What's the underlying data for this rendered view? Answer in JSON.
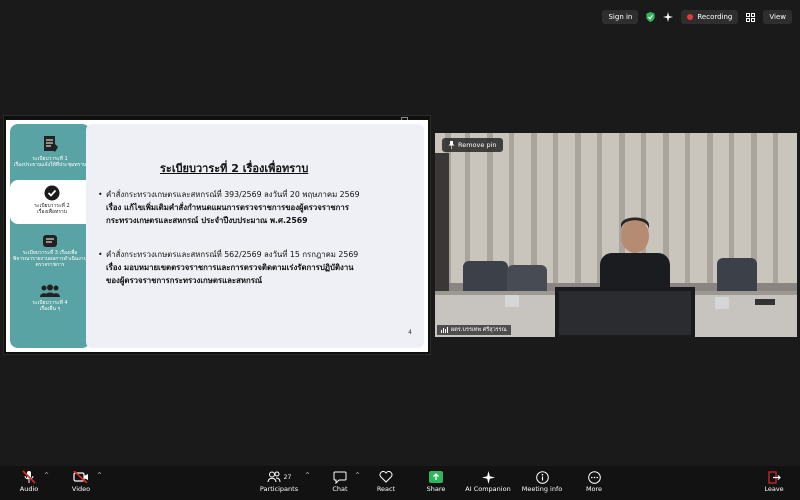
{
  "topbar": {
    "signin": "Sign in",
    "recording": "Recording",
    "view": "View"
  },
  "slide": {
    "sidebar": [
      {
        "label1": "ระเบียบวาระที่ 1",
        "label2": "เรื่องประธานแจ้งให้ที่ประชุมทราบ"
      },
      {
        "label1": "ระเบียบวาระที่ 2",
        "label2": "เรื่องเพื่อทราบ"
      },
      {
        "label1": "ระเบียบวาระที่ 3 เรื่องเพื่อ",
        "label2": "พิจารณารายงานผลการดำเนินงาน",
        "label3": "ตรวจราชการ"
      },
      {
        "label1": "ระเบียบวาระที่ 4",
        "label2": "เรื่องอื่น ๆ"
      }
    ],
    "title": "ระเบียบวาระที่ 2 เรื่องเพื่อทราบ",
    "bullets": [
      {
        "line1": "คำสั่งกระทรวงเกษตรและสหกรณ์ที่ 393/2569 ลงวันที่ 20 พฤษภาคม 2569",
        "line2": "เรื่อง แก้ไขเพิ่มเติมคำสั่งกำหนดแผนการตรวจราชการของผู้ตรวจราชการ",
        "line3": "กระทรวงเกษตรและสหกรณ์ ประจำปีงบประมาณ พ.ศ.2569"
      },
      {
        "line1": "คำสั่งกระทรวงเกษตรและสหกรณ์ที่ 562/2569 ลงวันที่ 15 กรกฎาคม 2569",
        "line2": "เรื่อง มอบหมายเขตตรวจราชการและการตรวจติดตามเร่งรัดการปฏิบัติงาน",
        "line3": "ของผู้ตรวจราชการกระทรวงเกษตรและสหกรณ์"
      }
    ],
    "page": "4"
  },
  "video": {
    "remove_pin": "Remove pin",
    "participant_name": "ผตร.บรรเทพ  ศรีสุวรรณ"
  },
  "toolbar": {
    "audio": "Audio",
    "video": "Video",
    "participants": "Participants",
    "participant_count": "27",
    "chat": "Chat",
    "react": "React",
    "share": "Share",
    "ai": "AI Companion",
    "meeting_info": "Meeting info",
    "more": "More",
    "leave": "Leave"
  },
  "colors": {
    "accent_green": "#2fb55d",
    "record_red": "#e5393a",
    "sidebar_teal": "#5aa3a4",
    "leave_red": "#e02828"
  }
}
